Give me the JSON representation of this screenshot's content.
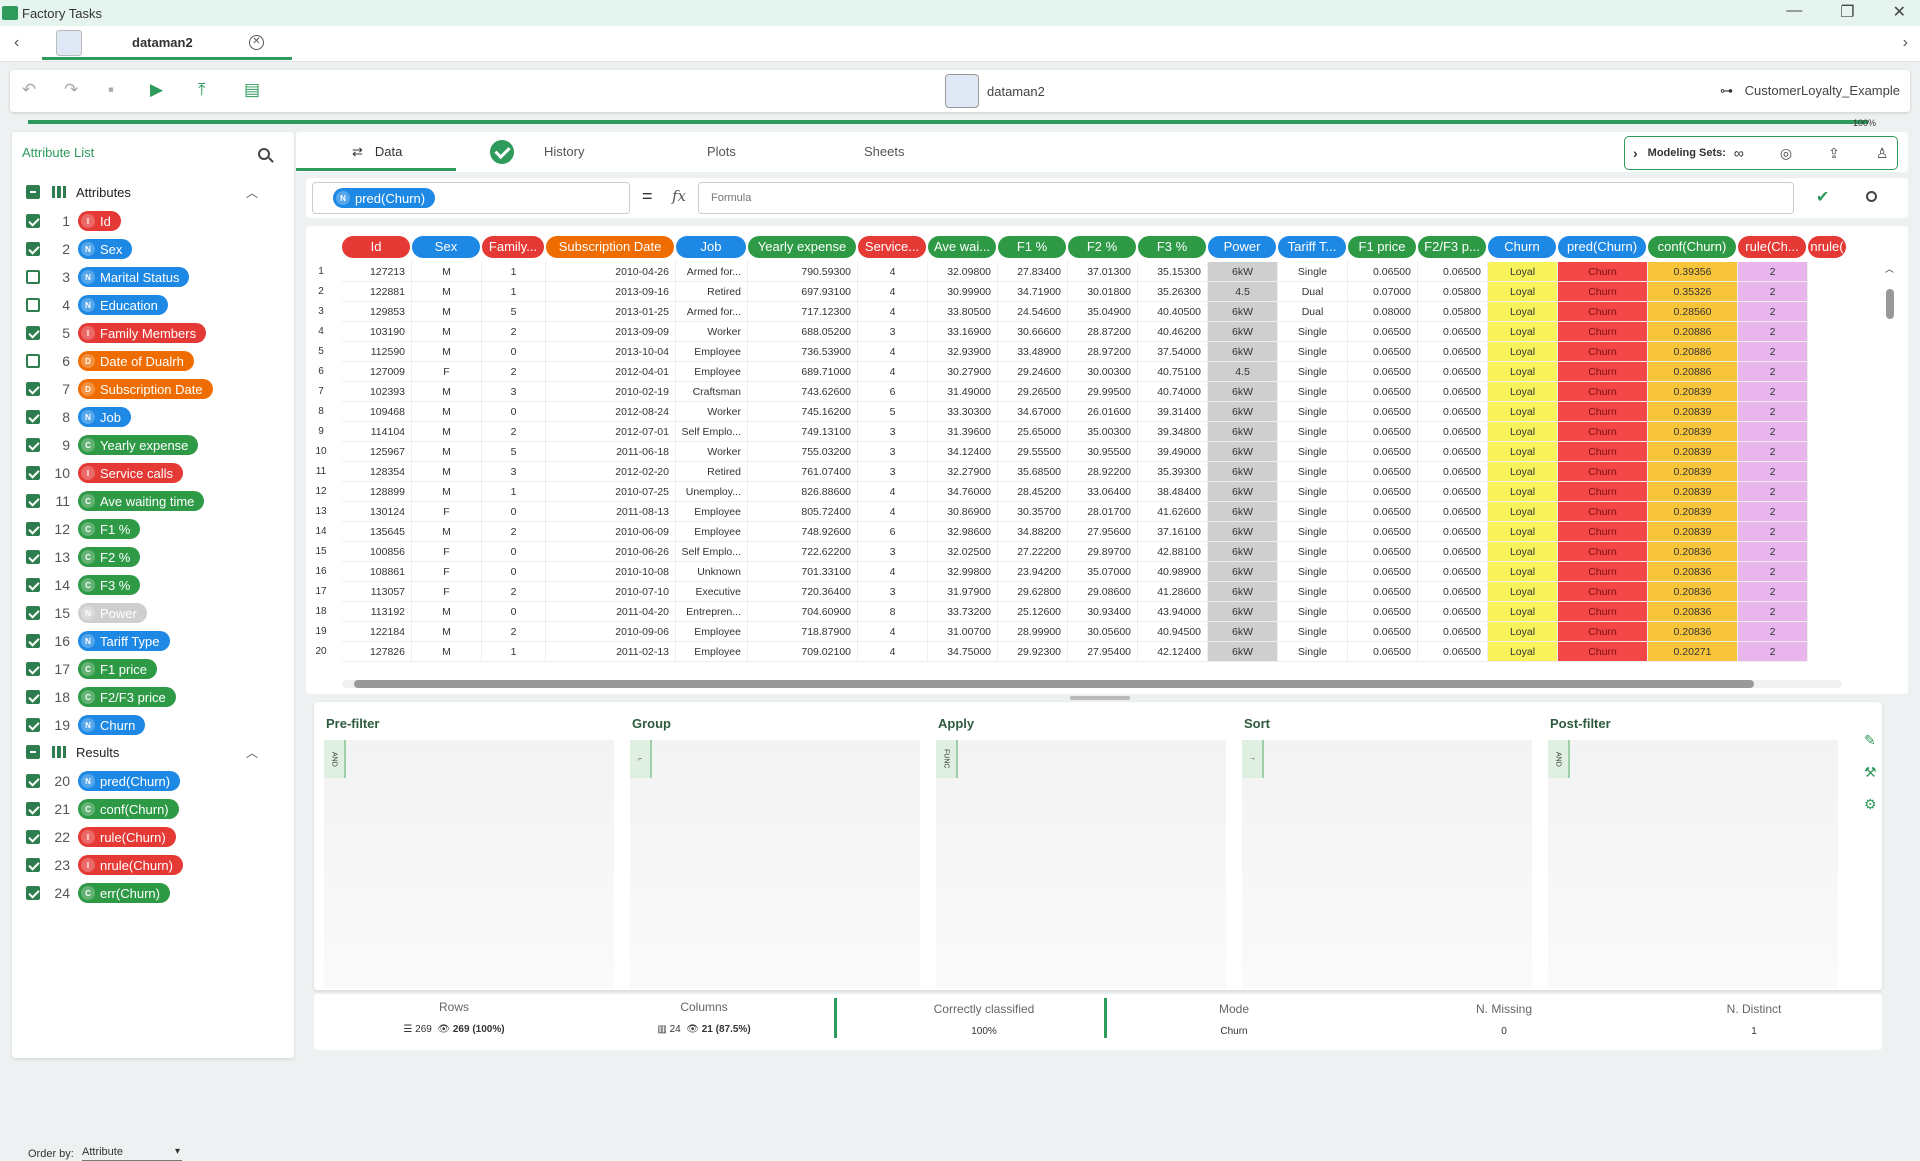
{
  "window": {
    "app_title": "Factory Tasks",
    "minimize": "—",
    "maximize": "❐",
    "close": "✕"
  },
  "tabbar": {
    "back": "‹",
    "forward": "›",
    "tab_label": "dataman2",
    "tab_close": "✕"
  },
  "toolbar": {
    "task_name": "dataman2",
    "project_name": "CustomerLoyalty_Example",
    "undo": "↶",
    "redo": "↷",
    "save": "▪",
    "run": "▶",
    "export": "⤒",
    "doc": "▤"
  },
  "progress": {
    "percent_label": "100%",
    "value": 1.0
  },
  "attribute_list": {
    "title": "Attribute List",
    "groups": [
      {
        "label": "Attributes",
        "caret": "︿"
      },
      {
        "label": "Results",
        "caret": "︿"
      }
    ],
    "attributes": [
      {
        "n": "1",
        "label": "Id",
        "badge": "I",
        "color": "#e53935",
        "checked": true
      },
      {
        "n": "2",
        "label": "Sex",
        "badge": "N",
        "color": "#1e88e5",
        "checked": true
      },
      {
        "n": "3",
        "label": "Marital Status",
        "badge": "N",
        "color": "#1e88e5",
        "checked": false
      },
      {
        "n": "4",
        "label": "Education",
        "badge": "N",
        "color": "#1e88e5",
        "checked": false
      },
      {
        "n": "5",
        "label": "Family Members",
        "badge": "I",
        "color": "#e53935",
        "checked": true
      },
      {
        "n": "6",
        "label": "Date of Dualrh",
        "badge": "D",
        "color": "#ef6c00",
        "checked": false
      },
      {
        "n": "7",
        "label": "Subscription Date",
        "badge": "D",
        "color": "#ef6c00",
        "checked": true
      },
      {
        "n": "8",
        "label": "Job",
        "badge": "N",
        "color": "#1e88e5",
        "checked": true
      },
      {
        "n": "9",
        "label": "Yearly expense",
        "badge": "C",
        "color": "#2e9a46",
        "checked": true
      },
      {
        "n": "10",
        "label": "Service calls",
        "badge": "I",
        "color": "#e53935",
        "checked": true
      },
      {
        "n": "11",
        "label": "Ave waiting time",
        "badge": "C",
        "color": "#2e9a46",
        "checked": true
      },
      {
        "n": "12",
        "label": "F1 %",
        "badge": "C",
        "color": "#2e9a46",
        "checked": true
      },
      {
        "n": "13",
        "label": "F2 %",
        "badge": "C",
        "color": "#2e9a46",
        "checked": true
      },
      {
        "n": "14",
        "label": "F3 %",
        "badge": "C",
        "color": "#2e9a46",
        "checked": true
      },
      {
        "n": "15",
        "label": "Power",
        "badge": "N",
        "color": "#cfcfcf",
        "checked": true
      },
      {
        "n": "16",
        "label": "Tariff Type",
        "badge": "N",
        "color": "#1e88e5",
        "checked": true
      },
      {
        "n": "17",
        "label": "F1 price",
        "badge": "C",
        "color": "#2e9a46",
        "checked": true
      },
      {
        "n": "18",
        "label": "F2/F3 price",
        "badge": "C",
        "color": "#2e9a46",
        "checked": true
      },
      {
        "n": "19",
        "label": "Churn",
        "badge": "N",
        "color": "#1e88e5",
        "checked": true
      }
    ],
    "results": [
      {
        "n": "20",
        "label": "pred(Churn)",
        "badge": "N",
        "color": "#1e88e5",
        "checked": true
      },
      {
        "n": "21",
        "label": "conf(Churn)",
        "badge": "C",
        "color": "#2e9a46",
        "checked": true
      },
      {
        "n": "22",
        "label": "rule(Churn)",
        "badge": "I",
        "color": "#e53935",
        "checked": true
      },
      {
        "n": "23",
        "label": "nrule(Churn)",
        "badge": "I",
        "color": "#e53935",
        "checked": true
      },
      {
        "n": "24",
        "label": "err(Churn)",
        "badge": "C",
        "color": "#2e9a46",
        "checked": true
      }
    ],
    "order_by_label": "Order by:",
    "order_by_value": "Attribute"
  },
  "main_tabs": [
    "Data",
    "History",
    "Plots",
    "Sheets"
  ],
  "modeling_sets_label": "Modeling Sets:",
  "formula": {
    "attribute": "pred(Churn)",
    "attribute_badge": "N",
    "equals": "=",
    "fx": "fx",
    "placeholder": "Formula"
  },
  "grid": {
    "columns": [
      {
        "label": "Id",
        "color": "#e53935"
      },
      {
        "label": "Sex",
        "color": "#1e88e5"
      },
      {
        "label": "Family...",
        "color": "#e53935"
      },
      {
        "label": "Subscription Date",
        "color": "#ef6c00"
      },
      {
        "label": "Job",
        "color": "#1e88e5"
      },
      {
        "label": "Yearly expense",
        "color": "#2e9a46"
      },
      {
        "label": "Service...",
        "color": "#e53935"
      },
      {
        "label": "Ave wai...",
        "color": "#2e9a46"
      },
      {
        "label": "F1 %",
        "color": "#2e9a46"
      },
      {
        "label": "F2 %",
        "color": "#2e9a46"
      },
      {
        "label": "F3 %",
        "color": "#2e9a46"
      },
      {
        "label": "Power",
        "color": "#1e88e5"
      },
      {
        "label": "Tariff T...",
        "color": "#1e88e5"
      },
      {
        "label": "F1 price",
        "color": "#2e9a46"
      },
      {
        "label": "F2/F3 p...",
        "color": "#2e9a46"
      },
      {
        "label": "Churn",
        "color": "#1e88e5"
      },
      {
        "label": "pred(Churn)",
        "color": "#1e88e5"
      },
      {
        "label": "conf(Churn)",
        "color": "#2e9a46"
      },
      {
        "label": "rule(Ch...",
        "color": "#e53935"
      },
      {
        "label": "nrule(",
        "color": "#e53935"
      }
    ],
    "rows": [
      [
        "127213",
        "M",
        "1",
        "2010-04-26",
        "Armed for...",
        "790.59300",
        "4",
        "32.09800",
        "27.83400",
        "37.01300",
        "35.15300",
        "6kW",
        "Single",
        "0.06500",
        "0.06500",
        "Loyal",
        "Churn",
        "0.39356",
        "2"
      ],
      [
        "122881",
        "M",
        "1",
        "2013-09-16",
        "Retired",
        "697.93100",
        "4",
        "30.99900",
        "34.71900",
        "30.01800",
        "35.26300",
        "4.5",
        "Dual",
        "0.07000",
        "0.05800",
        "Loyal",
        "Churn",
        "0.35326",
        "2"
      ],
      [
        "129853",
        "M",
        "5",
        "2013-01-25",
        "Armed for...",
        "717.12300",
        "4",
        "33.80500",
        "24.54600",
        "35.04900",
        "40.40500",
        "6kW",
        "Dual",
        "0.08000",
        "0.05800",
        "Loyal",
        "Churn",
        "0.28560",
        "2"
      ],
      [
        "103190",
        "M",
        "2",
        "2013-09-09",
        "Worker",
        "688.05200",
        "3",
        "33.16900",
        "30.66600",
        "28.87200",
        "40.46200",
        "6kW",
        "Single",
        "0.06500",
        "0.06500",
        "Loyal",
        "Churn",
        "0.20886",
        "2"
      ],
      [
        "112590",
        "M",
        "0",
        "2013-10-04",
        "Employee",
        "736.53900",
        "4",
        "32.93900",
        "33.48900",
        "28.97200",
        "37.54000",
        "6kW",
        "Single",
        "0.06500",
        "0.06500",
        "Loyal",
        "Churn",
        "0.20886",
        "2"
      ],
      [
        "127009",
        "F",
        "2",
        "2012-04-01",
        "Employee",
        "689.71000",
        "4",
        "30.27900",
        "29.24600",
        "30.00300",
        "40.75100",
        "4.5",
        "Single",
        "0.06500",
        "0.06500",
        "Loyal",
        "Churn",
        "0.20886",
        "2"
      ],
      [
        "102393",
        "M",
        "3",
        "2010-02-19",
        "Craftsman",
        "743.62600",
        "6",
        "31.49000",
        "29.26500",
        "29.99500",
        "40.74000",
        "6kW",
        "Single",
        "0.06500",
        "0.06500",
        "Loyal",
        "Churn",
        "0.20839",
        "2"
      ],
      [
        "109468",
        "M",
        "0",
        "2012-08-24",
        "Worker",
        "745.16200",
        "5",
        "33.30300",
        "34.67000",
        "26.01600",
        "39.31400",
        "6kW",
        "Single",
        "0.06500",
        "0.06500",
        "Loyal",
        "Churn",
        "0.20839",
        "2"
      ],
      [
        "114104",
        "M",
        "2",
        "2012-07-01",
        "Self Emplo...",
        "749.13100",
        "3",
        "31.39600",
        "25.65000",
        "35.00300",
        "39.34800",
        "6kW",
        "Single",
        "0.06500",
        "0.06500",
        "Loyal",
        "Churn",
        "0.20839",
        "2"
      ],
      [
        "125967",
        "M",
        "5",
        "2011-06-18",
        "Worker",
        "755.03200",
        "3",
        "34.12400",
        "29.55500",
        "30.95500",
        "39.49000",
        "6kW",
        "Single",
        "0.06500",
        "0.06500",
        "Loyal",
        "Churn",
        "0.20839",
        "2"
      ],
      [
        "128354",
        "M",
        "3",
        "2012-02-20",
        "Retired",
        "761.07400",
        "3",
        "32.27900",
        "35.68500",
        "28.92200",
        "35.39300",
        "6kW",
        "Single",
        "0.06500",
        "0.06500",
        "Loyal",
        "Churn",
        "0.20839",
        "2"
      ],
      [
        "128899",
        "M",
        "1",
        "2010-07-25",
        "Unemploy...",
        "826.88600",
        "4",
        "34.76000",
        "28.45200",
        "33.06400",
        "38.48400",
        "6kW",
        "Single",
        "0.06500",
        "0.06500",
        "Loyal",
        "Churn",
        "0.20839",
        "2"
      ],
      [
        "130124",
        "F",
        "0",
        "2011-08-13",
        "Employee",
        "805.72400",
        "4",
        "30.86900",
        "30.35700",
        "28.01700",
        "41.62600",
        "6kW",
        "Single",
        "0.06500",
        "0.06500",
        "Loyal",
        "Churn",
        "0.20839",
        "2"
      ],
      [
        "135645",
        "M",
        "2",
        "2010-06-09",
        "Employee",
        "748.92600",
        "6",
        "32.98600",
        "34.88200",
        "27.95600",
        "37.16100",
        "6kW",
        "Single",
        "0.06500",
        "0.06500",
        "Loyal",
        "Churn",
        "0.20839",
        "2"
      ],
      [
        "100856",
        "F",
        "0",
        "2010-06-26",
        "Self Emplo...",
        "722.62200",
        "3",
        "32.02500",
        "27.22200",
        "29.89700",
        "42.88100",
        "6kW",
        "Single",
        "0.06500",
        "0.06500",
        "Loyal",
        "Churn",
        "0.20836",
        "2"
      ],
      [
        "108861",
        "F",
        "0",
        "2010-10-08",
        "Unknown",
        "701.33100",
        "4",
        "32.99800",
        "23.94200",
        "35.07000",
        "40.98900",
        "6kW",
        "Single",
        "0.06500",
        "0.06500",
        "Loyal",
        "Churn",
        "0.20836",
        "2"
      ],
      [
        "113057",
        "F",
        "2",
        "2010-07-10",
        "Executive",
        "720.36400",
        "3",
        "31.97900",
        "29.62800",
        "29.08600",
        "41.28600",
        "6kW",
        "Single",
        "0.06500",
        "0.06500",
        "Loyal",
        "Churn",
        "0.20836",
        "2"
      ],
      [
        "113192",
        "M",
        "0",
        "2011-04-20",
        "Entrepren...",
        "704.60900",
        "8",
        "33.73200",
        "25.12600",
        "30.93400",
        "43.94000",
        "6kW",
        "Single",
        "0.06500",
        "0.06500",
        "Loyal",
        "Churn",
        "0.20836",
        "2"
      ],
      [
        "122184",
        "M",
        "2",
        "2010-09-06",
        "Employee",
        "718.87900",
        "4",
        "31.00700",
        "28.99900",
        "30.05600",
        "40.94500",
        "6kW",
        "Single",
        "0.06500",
        "0.06500",
        "Loyal",
        "Churn",
        "0.20836",
        "2"
      ],
      [
        "127826",
        "M",
        "1",
        "2011-02-13",
        "Employee",
        "709.02100",
        "4",
        "34.75000",
        "29.92300",
        "27.95400",
        "42.12400",
        "6kW",
        "Single",
        "0.06500",
        "0.06500",
        "Loyal",
        "Churn",
        "0.20271",
        "2"
      ]
    ]
  },
  "operations": [
    {
      "title": "Pre-filter",
      "tab": "AND"
    },
    {
      "title": "Group",
      "tab": "⌐"
    },
    {
      "title": "Apply",
      "tab": "FUNC"
    },
    {
      "title": "Sort",
      "tab": "↑"
    },
    {
      "title": "Post-filter",
      "tab": "AND"
    }
  ],
  "status": {
    "rows_label": "Rows",
    "rows_total": "269",
    "rows_visible": "269 (100%)",
    "columns_label": "Columns",
    "columns_total": "24",
    "columns_visible": "21 (87.5%)",
    "correct_label": "Correctly classified",
    "correct_value": "100%",
    "mode_label": "Mode",
    "mode_value": "Churn",
    "missing_label": "N. Missing",
    "missing_value": "0",
    "distinct_label": "N. Distinct",
    "distinct_value": "1"
  },
  "colors": {
    "accent": "#2e9a5b",
    "churn_col": "#f8f35a",
    "pred_col": "#f44848",
    "conf_col": "#f8c53a",
    "rule_col": "#e8b6ec",
    "power_col": "#cfcfcf"
  }
}
